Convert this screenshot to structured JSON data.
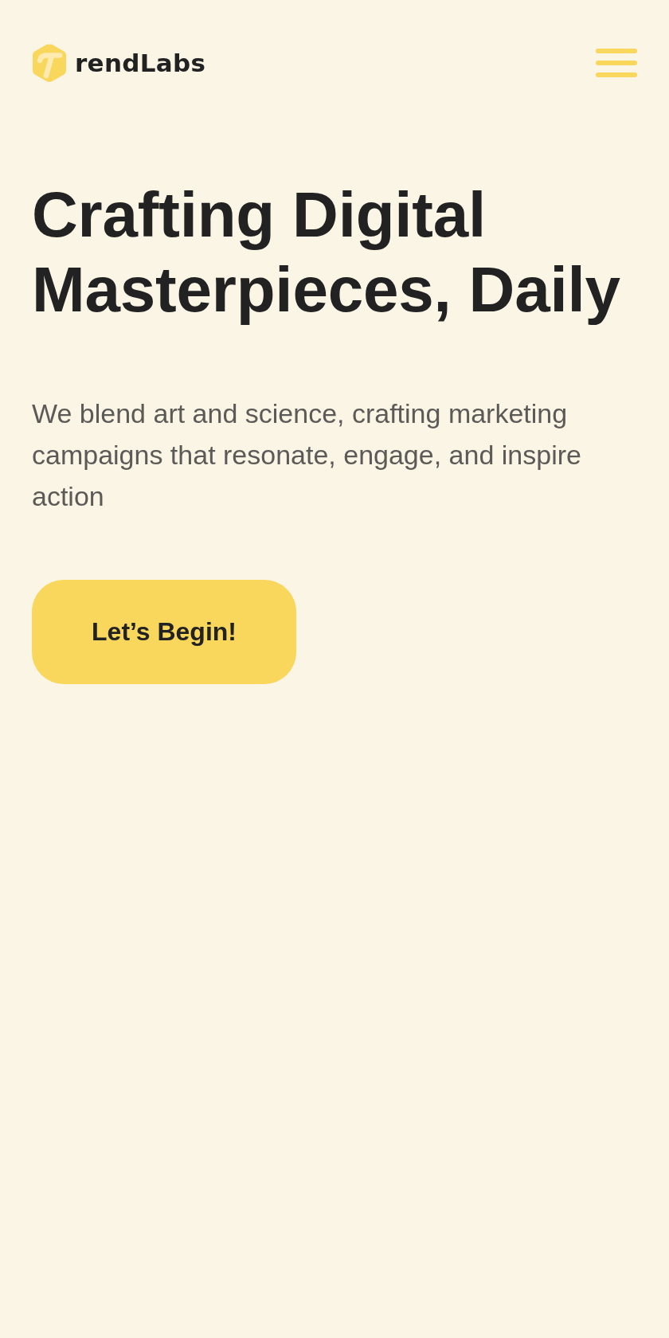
{
  "header": {
    "logo": {
      "text": "rendLabs"
    }
  },
  "hero": {
    "headline": "Crafting Digital Masterpieces, Daily",
    "description": "We blend art and science, crafting marketing campaigns that resonate, engage, and inspire action",
    "cta": {
      "label": "Let’s Begin!"
    }
  }
}
